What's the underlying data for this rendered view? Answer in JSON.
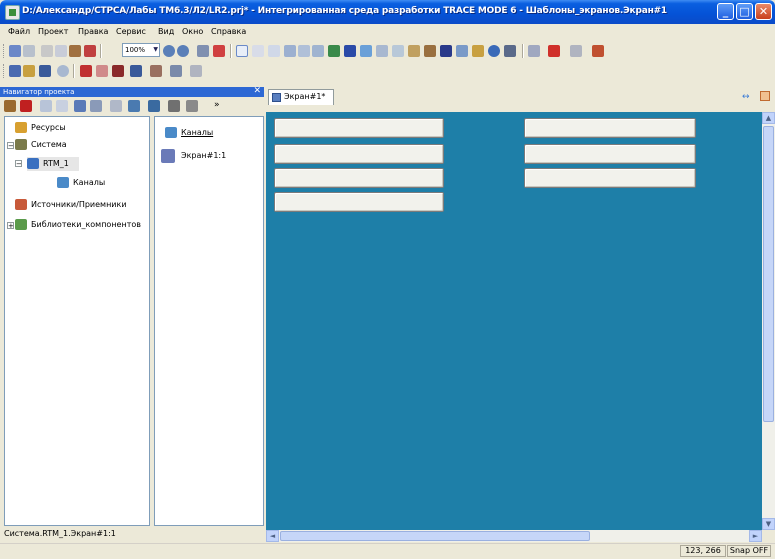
{
  "window": {
    "title": "D:/Александр/СТРСА/Лабы ТМ6.3/Л2/LR2.prj* - Интегрированная среда разработки TRACE MODE 6 - Шаблоны_экранов.Экран#1",
    "min": "_",
    "max": "□",
    "close": "✕"
  },
  "menu": [
    "Файл",
    "Проект",
    "Правка",
    "Сервис",
    "Вид",
    "Окно",
    "Справка"
  ],
  "toolbar": {
    "zoom": "100%"
  },
  "navigator": {
    "title": "Навигатор проекта",
    "close": "✕",
    "tree": [
      {
        "label": "Ресурсы",
        "icon": "resources-icon"
      },
      {
        "label": "Система",
        "icon": "system-icon",
        "expander": "−"
      },
      {
        "label": "RTM_1",
        "icon": "rtm-icon",
        "expander": "−"
      },
      {
        "label": "Каналы",
        "icon": "channels-icon"
      },
      {
        "label": "Источники/Приемники",
        "icon": "sources-icon"
      },
      {
        "label": "Библиотеки_компонентов",
        "icon": "library-icon",
        "expander": "+"
      }
    ],
    "list": [
      {
        "label": "Каналы",
        "icon": "channels-icon"
      },
      {
        "label": "Экран#1:1",
        "icon": "screen-icon"
      }
    ],
    "path": "Система.RTM_1.Экран#1:1"
  },
  "document": {
    "tab": "Экран#1*",
    "nav": "↔"
  },
  "scroll": {
    "up": "▲",
    "down": "▼",
    "left": "◄",
    "right": "►"
  },
  "status": {
    "coords": "123, 266",
    "snap": "Snap OFF"
  },
  "colors": {
    "canvas": "#1e7fa8",
    "titlebar": "#0552d6"
  }
}
